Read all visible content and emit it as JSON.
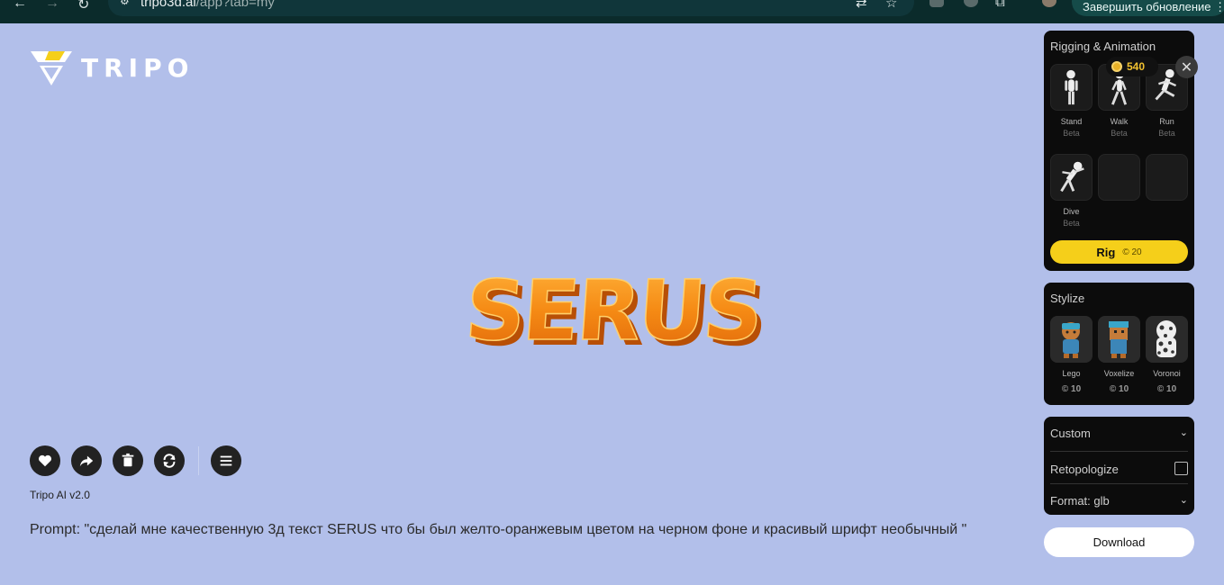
{
  "browser": {
    "url_host": "tripo3d.ai",
    "url_path": "/app?tab=my",
    "update_label": "Завершить обновление"
  },
  "brand": {
    "name": "TRIPO"
  },
  "model": {
    "text": "SERUS"
  },
  "viewer": {
    "version": "Tripo AI v2.0",
    "prompt": "Prompt: \"сделай мне качественную 3д текст SERUS что бы был желто-оранжевым цветом на черном фоне и красивый шрифт необычный \""
  },
  "rigging": {
    "title": "Rigging & Animation",
    "credits": "540",
    "animations": [
      {
        "label": "Stand",
        "sub": "Beta"
      },
      {
        "label": "Walk",
        "sub": "Beta"
      },
      {
        "label": "Run",
        "sub": "Beta"
      },
      {
        "label": "Dive",
        "sub": "Beta"
      }
    ],
    "rig_label": "Rig",
    "rig_cost": "20"
  },
  "stylize": {
    "title": "Stylize",
    "styles": [
      {
        "label": "Lego",
        "cost": "10"
      },
      {
        "label": "Voxelize",
        "cost": "10"
      },
      {
        "label": "Voronoi",
        "cost": "10"
      }
    ]
  },
  "export": {
    "custom_label": "Custom",
    "retopologize_label": "Retopologize",
    "format_label": "Format: glb"
  },
  "download_label": "Download",
  "colors": {
    "accent": "#f5cf1a",
    "background": "#b2bfea",
    "panel": "#0c0c0c"
  }
}
